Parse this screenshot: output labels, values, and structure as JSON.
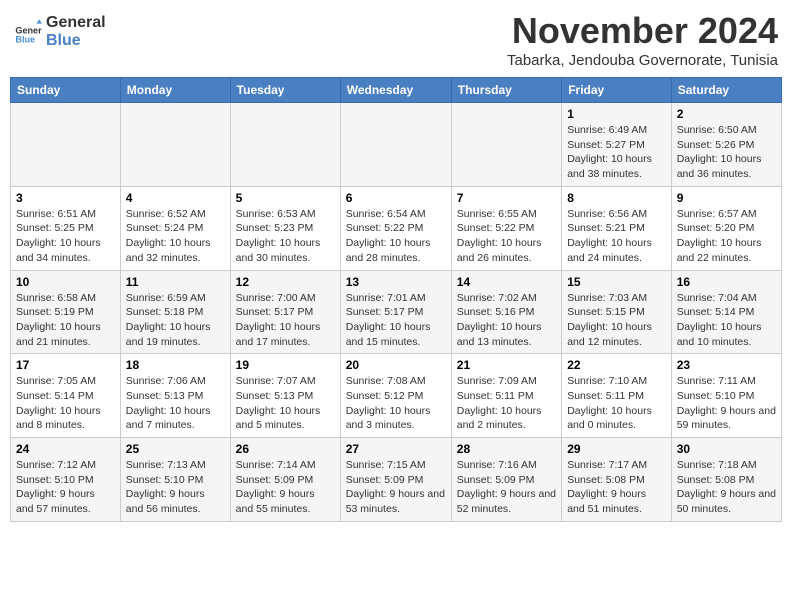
{
  "header": {
    "logo_line1": "General",
    "logo_line2": "Blue",
    "month": "November 2024",
    "location": "Tabarka, Jendouba Governorate, Tunisia"
  },
  "weekdays": [
    "Sunday",
    "Monday",
    "Tuesday",
    "Wednesday",
    "Thursday",
    "Friday",
    "Saturday"
  ],
  "weeks": [
    [
      {
        "day": "",
        "info": ""
      },
      {
        "day": "",
        "info": ""
      },
      {
        "day": "",
        "info": ""
      },
      {
        "day": "",
        "info": ""
      },
      {
        "day": "",
        "info": ""
      },
      {
        "day": "1",
        "info": "Sunrise: 6:49 AM\nSunset: 5:27 PM\nDaylight: 10 hours and 38 minutes."
      },
      {
        "day": "2",
        "info": "Sunrise: 6:50 AM\nSunset: 5:26 PM\nDaylight: 10 hours and 36 minutes."
      }
    ],
    [
      {
        "day": "3",
        "info": "Sunrise: 6:51 AM\nSunset: 5:25 PM\nDaylight: 10 hours and 34 minutes."
      },
      {
        "day": "4",
        "info": "Sunrise: 6:52 AM\nSunset: 5:24 PM\nDaylight: 10 hours and 32 minutes."
      },
      {
        "day": "5",
        "info": "Sunrise: 6:53 AM\nSunset: 5:23 PM\nDaylight: 10 hours and 30 minutes."
      },
      {
        "day": "6",
        "info": "Sunrise: 6:54 AM\nSunset: 5:22 PM\nDaylight: 10 hours and 28 minutes."
      },
      {
        "day": "7",
        "info": "Sunrise: 6:55 AM\nSunset: 5:22 PM\nDaylight: 10 hours and 26 minutes."
      },
      {
        "day": "8",
        "info": "Sunrise: 6:56 AM\nSunset: 5:21 PM\nDaylight: 10 hours and 24 minutes."
      },
      {
        "day": "9",
        "info": "Sunrise: 6:57 AM\nSunset: 5:20 PM\nDaylight: 10 hours and 22 minutes."
      }
    ],
    [
      {
        "day": "10",
        "info": "Sunrise: 6:58 AM\nSunset: 5:19 PM\nDaylight: 10 hours and 21 minutes."
      },
      {
        "day": "11",
        "info": "Sunrise: 6:59 AM\nSunset: 5:18 PM\nDaylight: 10 hours and 19 minutes."
      },
      {
        "day": "12",
        "info": "Sunrise: 7:00 AM\nSunset: 5:17 PM\nDaylight: 10 hours and 17 minutes."
      },
      {
        "day": "13",
        "info": "Sunrise: 7:01 AM\nSunset: 5:17 PM\nDaylight: 10 hours and 15 minutes."
      },
      {
        "day": "14",
        "info": "Sunrise: 7:02 AM\nSunset: 5:16 PM\nDaylight: 10 hours and 13 minutes."
      },
      {
        "day": "15",
        "info": "Sunrise: 7:03 AM\nSunset: 5:15 PM\nDaylight: 10 hours and 12 minutes."
      },
      {
        "day": "16",
        "info": "Sunrise: 7:04 AM\nSunset: 5:14 PM\nDaylight: 10 hours and 10 minutes."
      }
    ],
    [
      {
        "day": "17",
        "info": "Sunrise: 7:05 AM\nSunset: 5:14 PM\nDaylight: 10 hours and 8 minutes."
      },
      {
        "day": "18",
        "info": "Sunrise: 7:06 AM\nSunset: 5:13 PM\nDaylight: 10 hours and 7 minutes."
      },
      {
        "day": "19",
        "info": "Sunrise: 7:07 AM\nSunset: 5:13 PM\nDaylight: 10 hours and 5 minutes."
      },
      {
        "day": "20",
        "info": "Sunrise: 7:08 AM\nSunset: 5:12 PM\nDaylight: 10 hours and 3 minutes."
      },
      {
        "day": "21",
        "info": "Sunrise: 7:09 AM\nSunset: 5:11 PM\nDaylight: 10 hours and 2 minutes."
      },
      {
        "day": "22",
        "info": "Sunrise: 7:10 AM\nSunset: 5:11 PM\nDaylight: 10 hours and 0 minutes."
      },
      {
        "day": "23",
        "info": "Sunrise: 7:11 AM\nSunset: 5:10 PM\nDaylight: 9 hours and 59 minutes."
      }
    ],
    [
      {
        "day": "24",
        "info": "Sunrise: 7:12 AM\nSunset: 5:10 PM\nDaylight: 9 hours and 57 minutes."
      },
      {
        "day": "25",
        "info": "Sunrise: 7:13 AM\nSunset: 5:10 PM\nDaylight: 9 hours and 56 minutes."
      },
      {
        "day": "26",
        "info": "Sunrise: 7:14 AM\nSunset: 5:09 PM\nDaylight: 9 hours and 55 minutes."
      },
      {
        "day": "27",
        "info": "Sunrise: 7:15 AM\nSunset: 5:09 PM\nDaylight: 9 hours and 53 minutes."
      },
      {
        "day": "28",
        "info": "Sunrise: 7:16 AM\nSunset: 5:09 PM\nDaylight: 9 hours and 52 minutes."
      },
      {
        "day": "29",
        "info": "Sunrise: 7:17 AM\nSunset: 5:08 PM\nDaylight: 9 hours and 51 minutes."
      },
      {
        "day": "30",
        "info": "Sunrise: 7:18 AM\nSunset: 5:08 PM\nDaylight: 9 hours and 50 minutes."
      }
    ]
  ]
}
